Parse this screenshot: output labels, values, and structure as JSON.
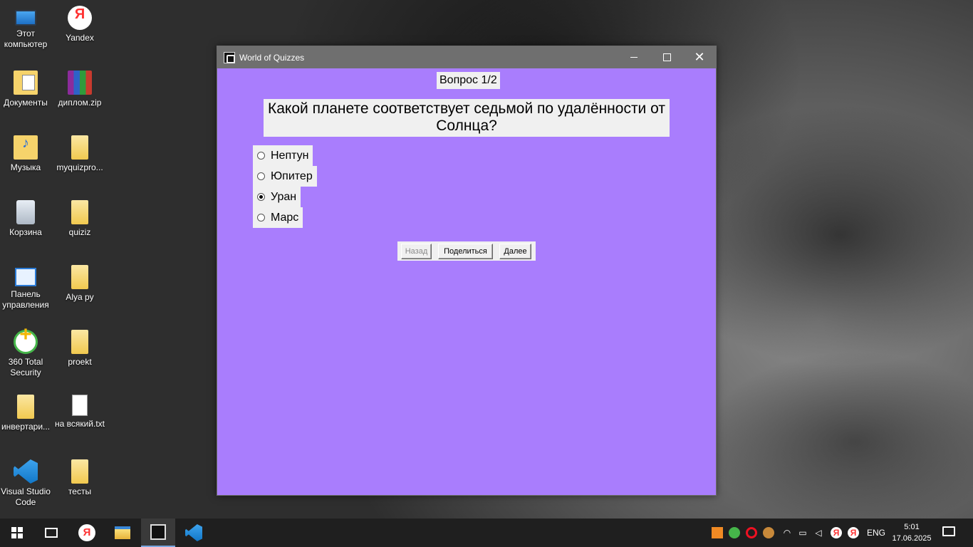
{
  "desktop": {
    "icons": [
      {
        "label": "Этот компьютер"
      },
      {
        "label": "Yandex"
      },
      {
        "label": "Документы"
      },
      {
        "label": "диплом.zip"
      },
      {
        "label": "Музыка"
      },
      {
        "label": "myquizpro..."
      },
      {
        "label": "Корзина"
      },
      {
        "label": "quiziz"
      },
      {
        "label": "Панель управления"
      },
      {
        "label": "Alya py"
      },
      {
        "label": "360 Total Security"
      },
      {
        "label": "proekt"
      },
      {
        "label": "инвертари..."
      },
      {
        "label": "на всякий.txt"
      },
      {
        "label": "Visual Studio Code"
      },
      {
        "label": "тесты"
      }
    ]
  },
  "window": {
    "title": "World of Quizzes",
    "accent_color": "#a97dfd",
    "counter": "Вопрос 1/2",
    "question": "Какой планете соответствует седьмой по удалённости от Солнца?",
    "options": [
      {
        "label": "Нептун",
        "checked": false
      },
      {
        "label": "Юпитер",
        "checked": false
      },
      {
        "label": "Уран",
        "checked": true
      },
      {
        "label": "Марс",
        "checked": false
      }
    ],
    "buttons": {
      "back": "Назад",
      "share": "Поделиться",
      "next": "Далее"
    }
  },
  "taskbar": {
    "language": "ENG",
    "time": "5:01",
    "date": "17.06.2025"
  }
}
